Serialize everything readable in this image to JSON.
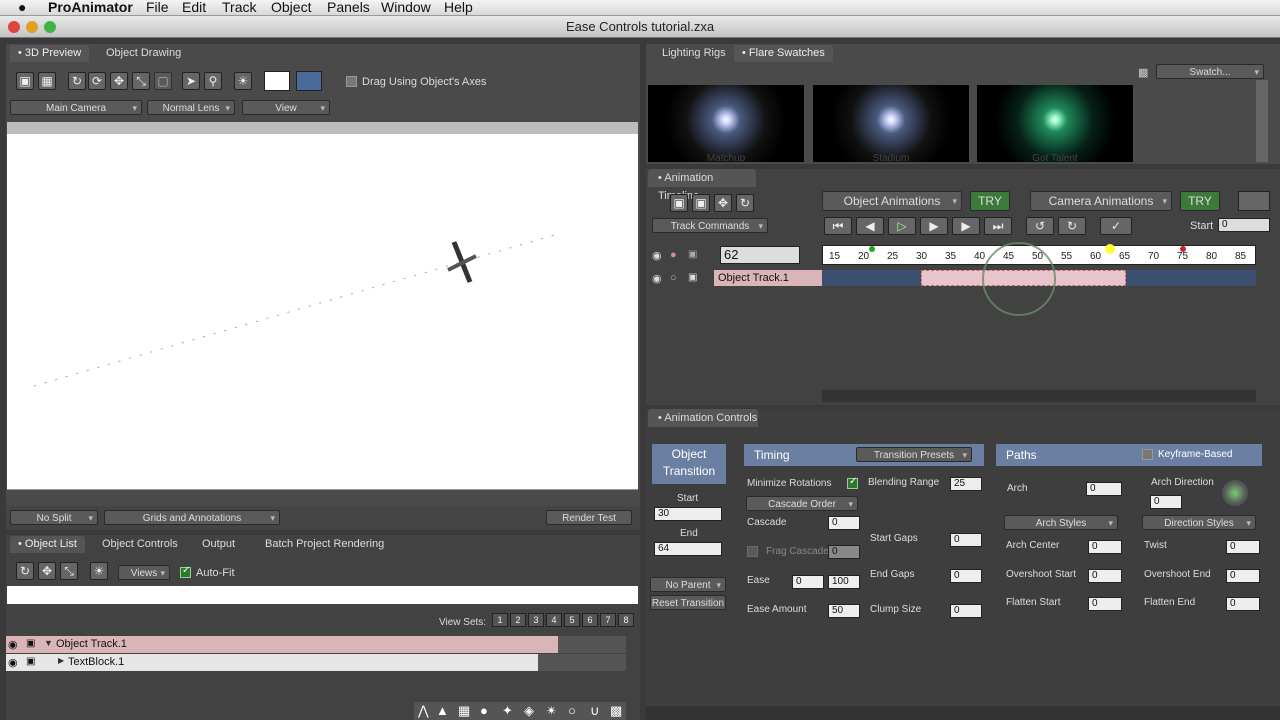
{
  "menubar": {
    "apple": "",
    "app": "ProAnimator",
    "items": [
      "File",
      "Edit",
      "Track",
      "Object",
      "Panels",
      "Window",
      "Help"
    ]
  },
  "window": {
    "title": "Ease Controls tutorial.zxa"
  },
  "preview": {
    "tabs": [
      "3D Preview",
      "Object Drawing"
    ],
    "drag_label": "Drag Using Object's Axes",
    "camera": "Main Camera",
    "lens": "Normal Lens",
    "view": "View",
    "split": "No Split",
    "grids": "Grids and Annotations",
    "render": "Render Test"
  },
  "objects": {
    "tabs": [
      "Object List",
      "Object Controls",
      "Output",
      "Batch Project Rendering"
    ],
    "views": "Views",
    "autofit": "Auto-Fit",
    "viewsets": "View Sets:",
    "viewset_nums": [
      "1",
      "2",
      "3",
      "4",
      "5",
      "6",
      "7",
      "8"
    ],
    "rows": [
      "Object Track.1",
      "TextBlock.1"
    ]
  },
  "swatches": {
    "tabs": [
      "Lighting Rigs",
      "Flare Swatches"
    ],
    "button": "Swatch...",
    "items": [
      {
        "name": "Matchup"
      },
      {
        "name": "Stadium"
      },
      {
        "name": "Got Talent"
      }
    ]
  },
  "timeline": {
    "header": "Animation Timeline",
    "obj_anim": "Object Animations",
    "try": "TRY",
    "cam_anim": "Camera Animations",
    "track_cmds": "Track Commands",
    "start_label": "Start",
    "start_val": "0",
    "frame": "62",
    "track_name": "Object Track.1",
    "ticks": [
      "15",
      "20",
      "25",
      "30",
      "35",
      "40",
      "45",
      "50",
      "55",
      "60",
      "65",
      "70",
      "75",
      "80",
      "85"
    ]
  },
  "controls": {
    "header": "Animation Controls",
    "obj_trans": "Object Transition",
    "start_label": "Start",
    "start_val": "30",
    "end_label": "End",
    "end_val": "64",
    "no_parent": "No Parent",
    "reset": "Reset Transition",
    "timing": {
      "title": "Timing",
      "presets": "Transition Presets",
      "min_rot": "Minimize Rotations",
      "cascade_order": "Cascade Order",
      "cascade": "Cascade",
      "cascade_val": "0",
      "frag": "Frag Cascade",
      "frag_val": "0",
      "ease": "Ease",
      "ease_a": "0",
      "ease_b": "100",
      "ease_amt": "Ease Amount",
      "ease_amt_val": "50",
      "blend": "Blending Range",
      "blend_val": "25",
      "start_gaps": "Start Gaps",
      "start_gaps_val": "0",
      "end_gaps": "End Gaps",
      "end_gaps_val": "0",
      "clump": "Clump Size",
      "clump_val": "0"
    },
    "paths": {
      "title": "Paths",
      "keyframe": "Keyframe-Based",
      "arch": "Arch",
      "arch_val": "0",
      "arch_dir": "Arch Direction",
      "arch_dir_val": "0",
      "arch_styles": "Arch Styles",
      "dir_styles": "Direction Styles",
      "arch_center": "Arch Center",
      "arch_center_val": "0",
      "twist": "Twist",
      "twist_val": "0",
      "over_start": "Overshoot Start",
      "over_start_val": "0",
      "over_end": "Overshoot End",
      "over_end_val": "0",
      "flat_start": "Flatten Start",
      "flat_start_val": "0",
      "flat_end": "Flatten End",
      "flat_end_val": "0"
    }
  }
}
